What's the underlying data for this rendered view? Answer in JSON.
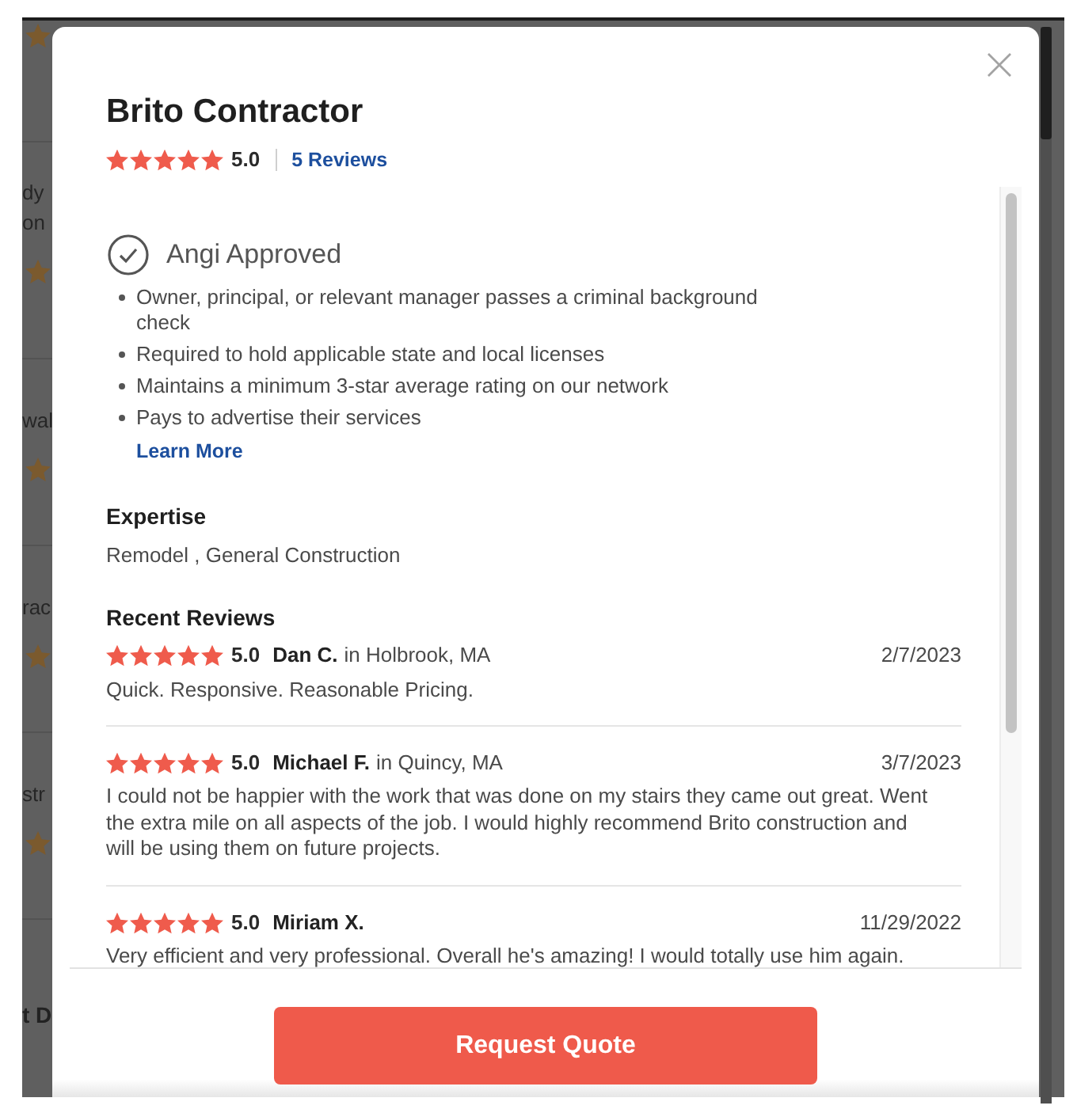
{
  "background": {
    "listings": [
      {
        "lines": [
          "dy",
          "on"
        ]
      },
      {
        "lines": [
          "wal"
        ]
      },
      {
        "lines": [
          "rac"
        ]
      },
      {
        "lines": [
          "str"
        ]
      }
    ],
    "heading": "t D"
  },
  "modal": {
    "title": "Brito Contractor",
    "rating": {
      "stars": 5,
      "score": "5.0",
      "reviews_link": "5 Reviews"
    },
    "approval": {
      "title": "Angi Approved",
      "points": [
        "Owner, principal, or relevant manager passes a criminal background check",
        "Required to hold applicable state and local licenses",
        "Maintains a minimum 3-star average rating on our network",
        "Pays to advertise their services"
      ],
      "link": "Learn More"
    },
    "expertise": {
      "heading": "Expertise",
      "text": "Remodel , General Construction"
    },
    "reviews": {
      "heading": "Recent Reviews",
      "items": [
        {
          "stars": 5,
          "score": "5.0",
          "author": "Dan C.",
          "location": "in Holbrook, MA",
          "date": "2/7/2023",
          "text": "Quick. Responsive. Reasonable Pricing."
        },
        {
          "stars": 5,
          "score": "5.0",
          "author": "Michael F.",
          "location": "in Quincy, MA",
          "date": "3/7/2023",
          "text": "I could not be happier with the work that was done on my stairs they came out great. Went the extra mile on all aspects of the job. I would highly recommend Brito construction and will be using them on future projects."
        },
        {
          "stars": 5,
          "score": "5.0",
          "author": "Miriam X.",
          "date": "11/29/2022",
          "text": "Very efficient and very professional. Overall he's amazing! I would totally use him again."
        }
      ]
    },
    "primary_button": "Request Quote"
  }
}
